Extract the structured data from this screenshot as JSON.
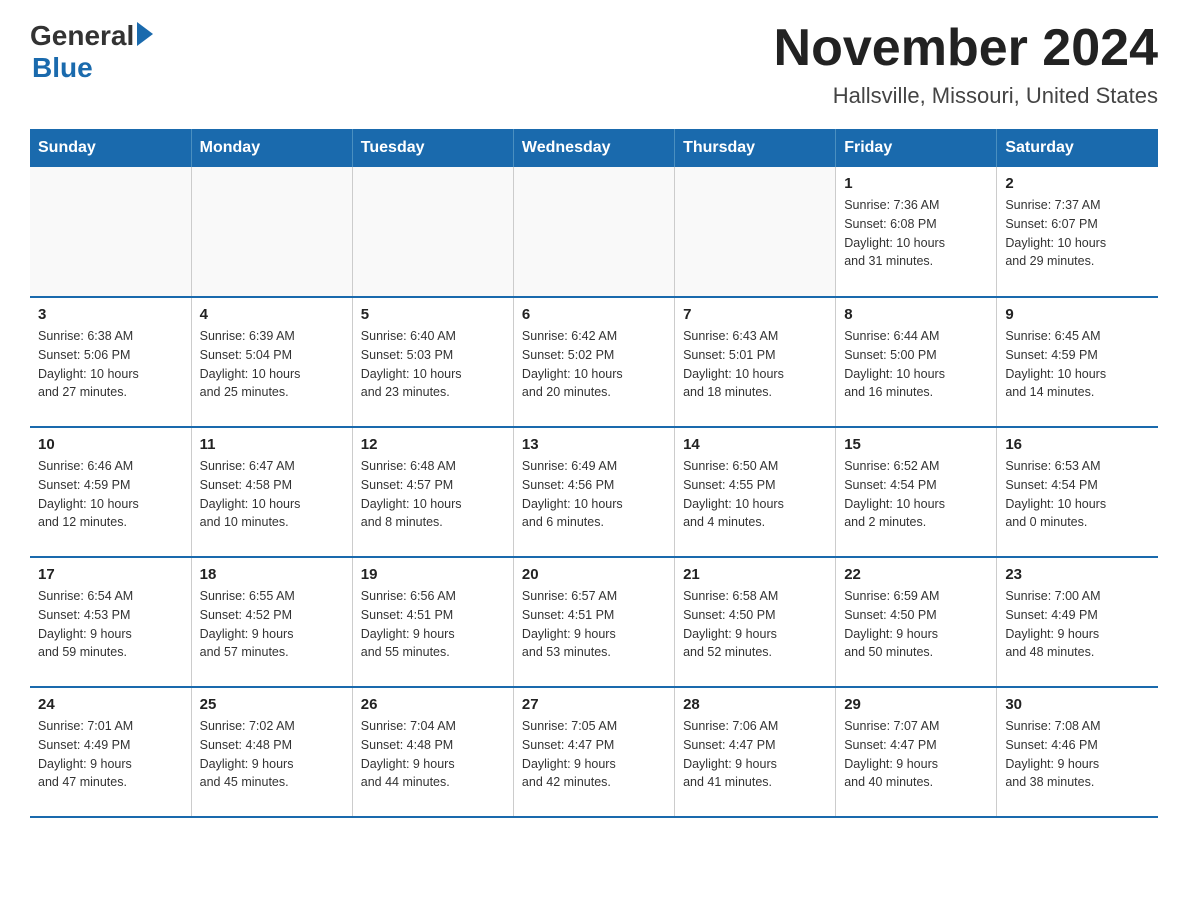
{
  "header": {
    "logo_general": "General",
    "logo_blue": "Blue",
    "title": "November 2024",
    "subtitle": "Hallsville, Missouri, United States"
  },
  "days_of_week": [
    "Sunday",
    "Monday",
    "Tuesday",
    "Wednesday",
    "Thursday",
    "Friday",
    "Saturday"
  ],
  "weeks": [
    [
      {
        "day": "",
        "info": ""
      },
      {
        "day": "",
        "info": ""
      },
      {
        "day": "",
        "info": ""
      },
      {
        "day": "",
        "info": ""
      },
      {
        "day": "",
        "info": ""
      },
      {
        "day": "1",
        "info": "Sunrise: 7:36 AM\nSunset: 6:08 PM\nDaylight: 10 hours\nand 31 minutes."
      },
      {
        "day": "2",
        "info": "Sunrise: 7:37 AM\nSunset: 6:07 PM\nDaylight: 10 hours\nand 29 minutes."
      }
    ],
    [
      {
        "day": "3",
        "info": "Sunrise: 6:38 AM\nSunset: 5:06 PM\nDaylight: 10 hours\nand 27 minutes."
      },
      {
        "day": "4",
        "info": "Sunrise: 6:39 AM\nSunset: 5:04 PM\nDaylight: 10 hours\nand 25 minutes."
      },
      {
        "day": "5",
        "info": "Sunrise: 6:40 AM\nSunset: 5:03 PM\nDaylight: 10 hours\nand 23 minutes."
      },
      {
        "day": "6",
        "info": "Sunrise: 6:42 AM\nSunset: 5:02 PM\nDaylight: 10 hours\nand 20 minutes."
      },
      {
        "day": "7",
        "info": "Sunrise: 6:43 AM\nSunset: 5:01 PM\nDaylight: 10 hours\nand 18 minutes."
      },
      {
        "day": "8",
        "info": "Sunrise: 6:44 AM\nSunset: 5:00 PM\nDaylight: 10 hours\nand 16 minutes."
      },
      {
        "day": "9",
        "info": "Sunrise: 6:45 AM\nSunset: 4:59 PM\nDaylight: 10 hours\nand 14 minutes."
      }
    ],
    [
      {
        "day": "10",
        "info": "Sunrise: 6:46 AM\nSunset: 4:59 PM\nDaylight: 10 hours\nand 12 minutes."
      },
      {
        "day": "11",
        "info": "Sunrise: 6:47 AM\nSunset: 4:58 PM\nDaylight: 10 hours\nand 10 minutes."
      },
      {
        "day": "12",
        "info": "Sunrise: 6:48 AM\nSunset: 4:57 PM\nDaylight: 10 hours\nand 8 minutes."
      },
      {
        "day": "13",
        "info": "Sunrise: 6:49 AM\nSunset: 4:56 PM\nDaylight: 10 hours\nand 6 minutes."
      },
      {
        "day": "14",
        "info": "Sunrise: 6:50 AM\nSunset: 4:55 PM\nDaylight: 10 hours\nand 4 minutes."
      },
      {
        "day": "15",
        "info": "Sunrise: 6:52 AM\nSunset: 4:54 PM\nDaylight: 10 hours\nand 2 minutes."
      },
      {
        "day": "16",
        "info": "Sunrise: 6:53 AM\nSunset: 4:54 PM\nDaylight: 10 hours\nand 0 minutes."
      }
    ],
    [
      {
        "day": "17",
        "info": "Sunrise: 6:54 AM\nSunset: 4:53 PM\nDaylight: 9 hours\nand 59 minutes."
      },
      {
        "day": "18",
        "info": "Sunrise: 6:55 AM\nSunset: 4:52 PM\nDaylight: 9 hours\nand 57 minutes."
      },
      {
        "day": "19",
        "info": "Sunrise: 6:56 AM\nSunset: 4:51 PM\nDaylight: 9 hours\nand 55 minutes."
      },
      {
        "day": "20",
        "info": "Sunrise: 6:57 AM\nSunset: 4:51 PM\nDaylight: 9 hours\nand 53 minutes."
      },
      {
        "day": "21",
        "info": "Sunrise: 6:58 AM\nSunset: 4:50 PM\nDaylight: 9 hours\nand 52 minutes."
      },
      {
        "day": "22",
        "info": "Sunrise: 6:59 AM\nSunset: 4:50 PM\nDaylight: 9 hours\nand 50 minutes."
      },
      {
        "day": "23",
        "info": "Sunrise: 7:00 AM\nSunset: 4:49 PM\nDaylight: 9 hours\nand 48 minutes."
      }
    ],
    [
      {
        "day": "24",
        "info": "Sunrise: 7:01 AM\nSunset: 4:49 PM\nDaylight: 9 hours\nand 47 minutes."
      },
      {
        "day": "25",
        "info": "Sunrise: 7:02 AM\nSunset: 4:48 PM\nDaylight: 9 hours\nand 45 minutes."
      },
      {
        "day": "26",
        "info": "Sunrise: 7:04 AM\nSunset: 4:48 PM\nDaylight: 9 hours\nand 44 minutes."
      },
      {
        "day": "27",
        "info": "Sunrise: 7:05 AM\nSunset: 4:47 PM\nDaylight: 9 hours\nand 42 minutes."
      },
      {
        "day": "28",
        "info": "Sunrise: 7:06 AM\nSunset: 4:47 PM\nDaylight: 9 hours\nand 41 minutes."
      },
      {
        "day": "29",
        "info": "Sunrise: 7:07 AM\nSunset: 4:47 PM\nDaylight: 9 hours\nand 40 minutes."
      },
      {
        "day": "30",
        "info": "Sunrise: 7:08 AM\nSunset: 4:46 PM\nDaylight: 9 hours\nand 38 minutes."
      }
    ]
  ]
}
